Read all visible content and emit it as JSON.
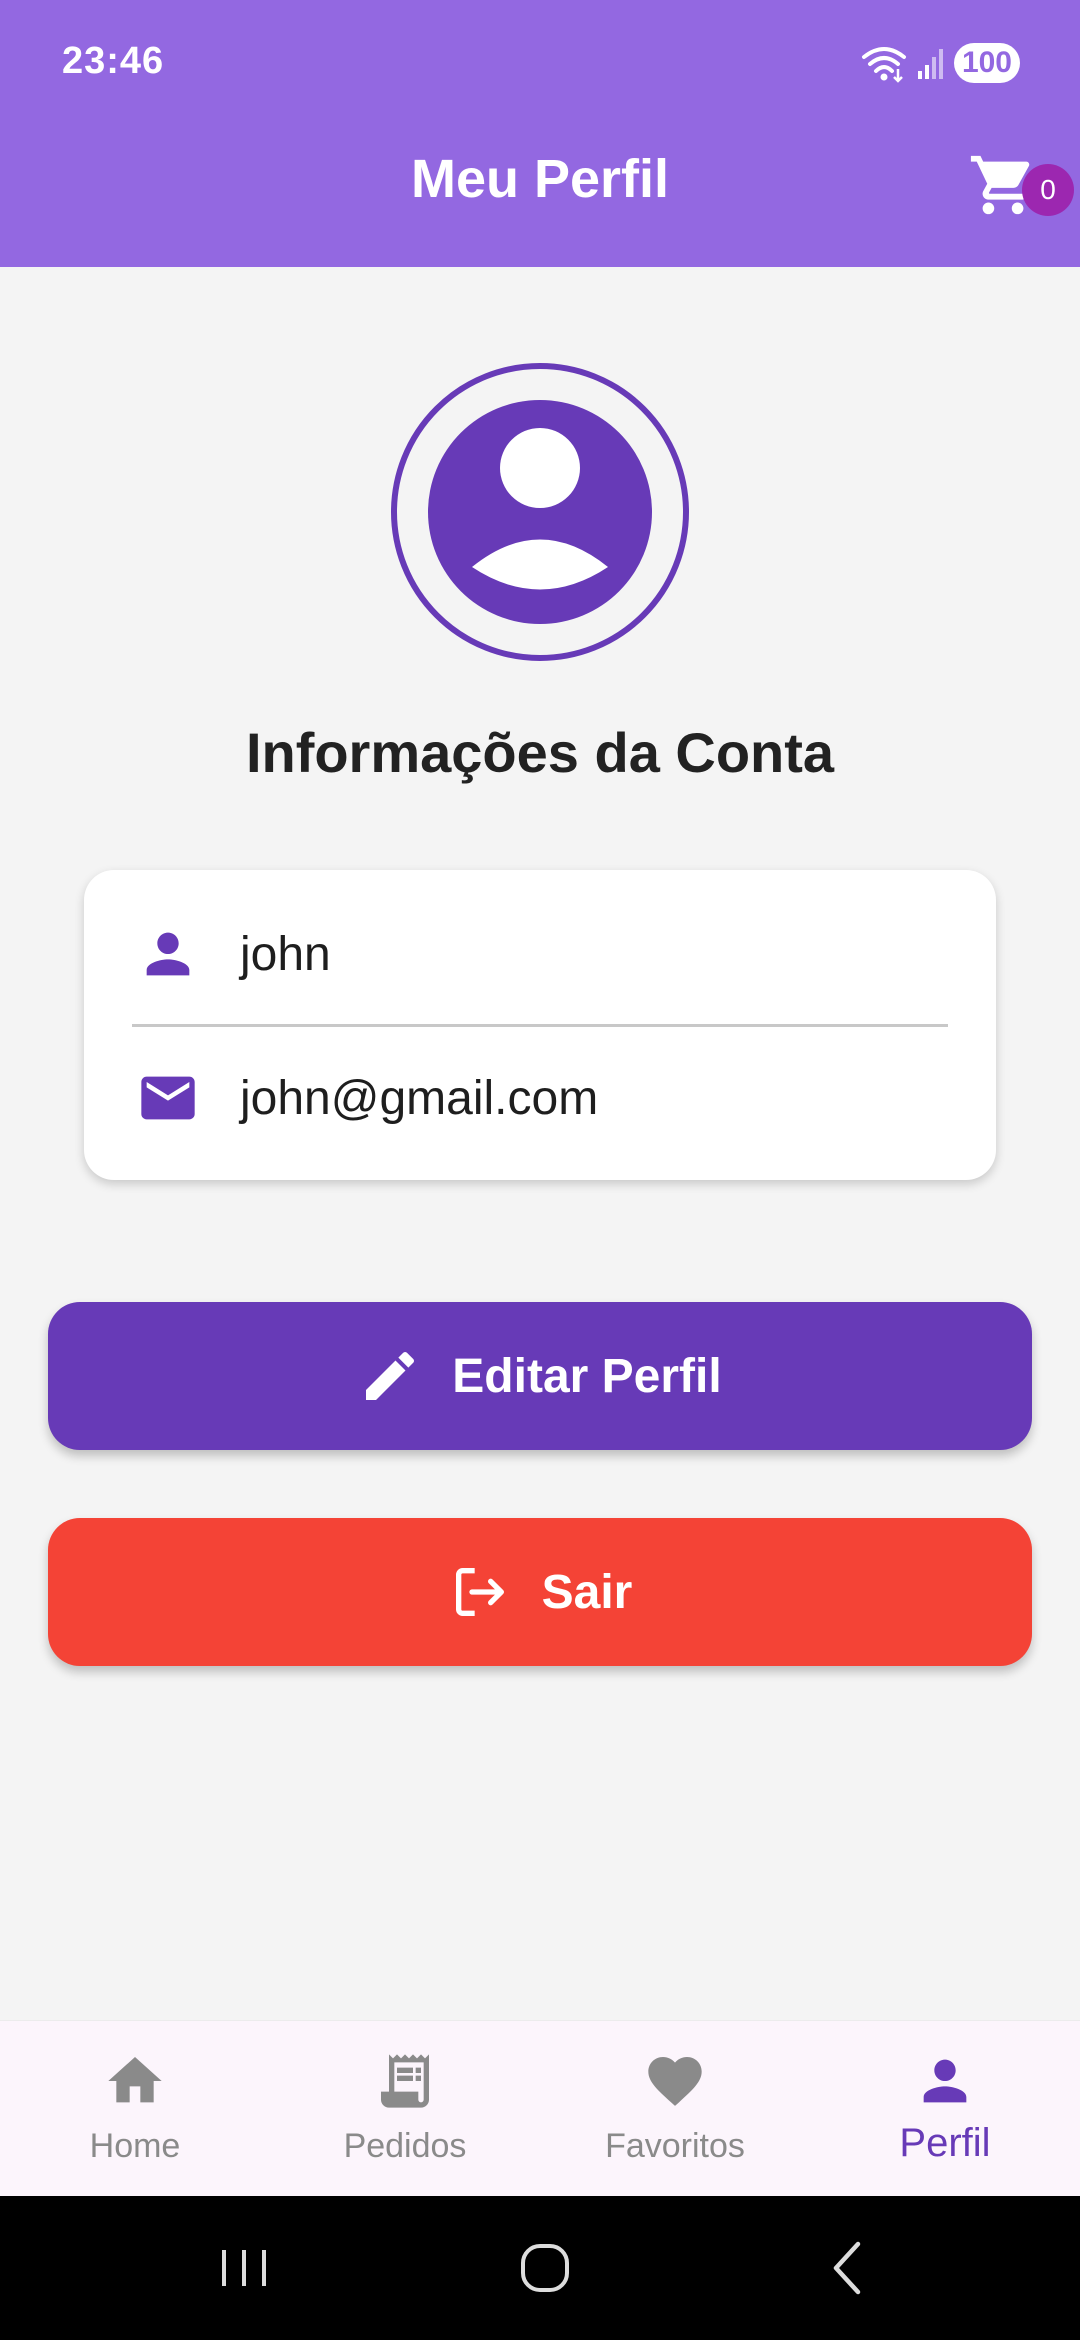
{
  "status_bar": {
    "time": "23:46",
    "battery": "100",
    "icons": [
      "wifi-icon",
      "signal-icon",
      "battery-icon"
    ]
  },
  "header": {
    "title": "Meu Perfil",
    "cart_icon": "cart-icon",
    "cart_count": "0"
  },
  "profile": {
    "avatar_icon": "account-circle-icon",
    "section_title": "Informações da Conta",
    "username": "john",
    "email": "john@gmail.com"
  },
  "actions": {
    "edit_label": "Editar Perfil",
    "edit_icon": "pencil-icon",
    "logout_label": "Sair",
    "logout_icon": "logout-icon"
  },
  "bottom_nav": {
    "items": [
      {
        "label": "Home",
        "icon": "home-icon",
        "active": false
      },
      {
        "label": "Pedidos",
        "icon": "receipt-icon",
        "active": false
      },
      {
        "label": "Favoritos",
        "icon": "heart-icon",
        "active": false
      },
      {
        "label": "Perfil",
        "icon": "person-icon",
        "active": true
      }
    ]
  },
  "colors": {
    "header": "#9368e1",
    "primary": "#673ab7",
    "danger": "#f44336",
    "badge": "#9c27b0",
    "background": "#f4f4f4",
    "inactive": "#8a8a8a"
  }
}
